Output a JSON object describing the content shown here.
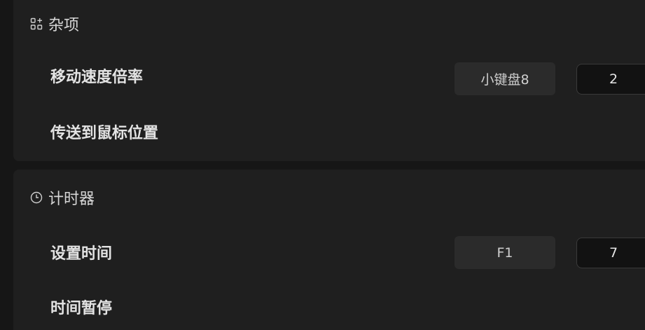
{
  "sections": [
    {
      "title": "杂项",
      "icon": "apps-add-icon",
      "rows": [
        {
          "label": "移动速度倍率",
          "key": "小键盘8",
          "value": "2"
        },
        {
          "label": "传送到鼠标位置"
        }
      ]
    },
    {
      "title": "计时器",
      "icon": "clock-icon",
      "rows": [
        {
          "label": "设置时间",
          "key": "F1",
          "value": "7"
        },
        {
          "label": "时间暂停"
        }
      ]
    }
  ]
}
